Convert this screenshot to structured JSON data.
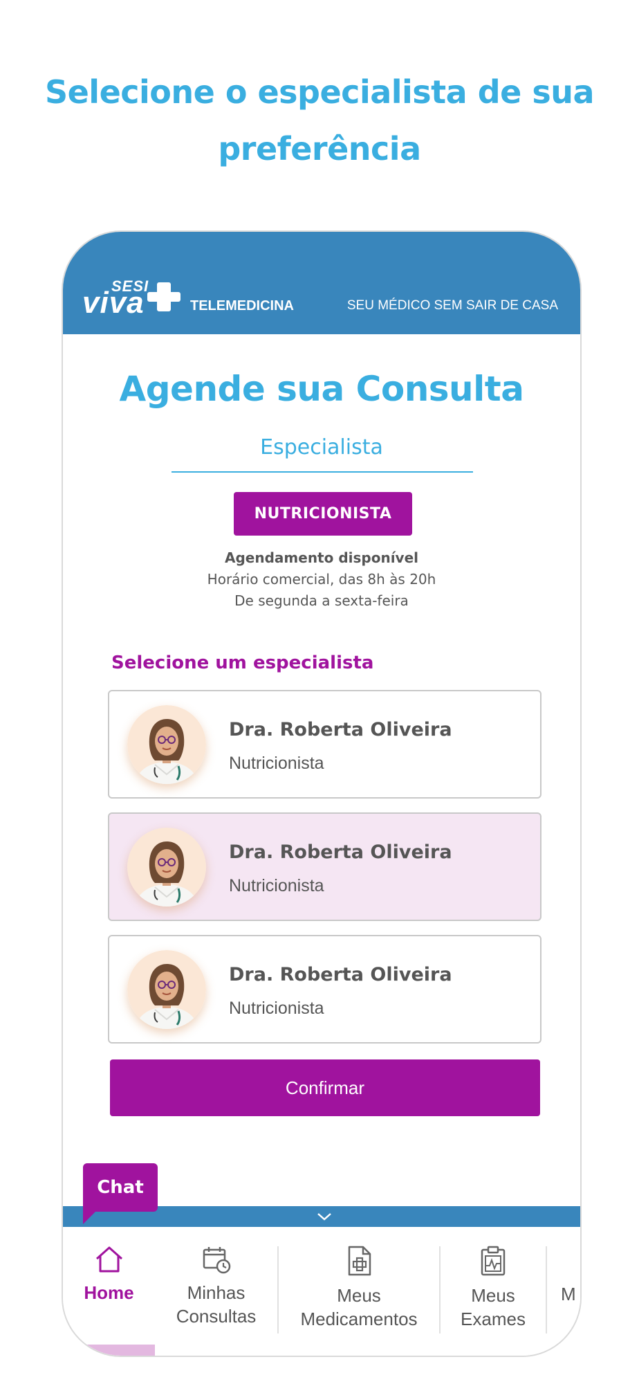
{
  "promo": {
    "headline": "Selecione o especialista de sua preferência"
  },
  "app_header": {
    "logo_sesi": "SESI",
    "logo_viva": "viva",
    "brand": "TELEMEDICINA",
    "slogan": "SEU MÉDICO SEM SAIR DE CASA"
  },
  "main": {
    "title": "Agende sua Consulta",
    "subtitle": "Especialista",
    "specialty": "NUTRICIONISTA",
    "availability": {
      "heading": "Agendamento disponível",
      "hours": "Horário comercial, das 8h às 20h",
      "days": "De segunda a sexta-feira"
    },
    "section_label": "Selecione um especialista",
    "doctors": [
      {
        "name": "Dra. Roberta Oliveira",
        "role": "Nutricionista",
        "selected": false
      },
      {
        "name": "Dra. Roberta Oliveira",
        "role": "Nutricionista",
        "selected": true
      },
      {
        "name": "Dra. Roberta Oliveira",
        "role": "Nutricionista",
        "selected": false
      }
    ],
    "confirm_label": "Confirmar"
  },
  "chat": {
    "label": "Chat"
  },
  "bottom_nav": {
    "items": [
      {
        "line1": "Home",
        "line2": "",
        "icon": "home-icon",
        "active": true
      },
      {
        "line1": "Minhas",
        "line2": "Consultas",
        "icon": "calendar-clock-icon",
        "active": false
      },
      {
        "line1": "Meus",
        "line2": "Medicamentos",
        "icon": "prescription-icon",
        "active": false
      },
      {
        "line1": "Meus",
        "line2": "Exames",
        "icon": "clipboard-chart-icon",
        "active": false
      },
      {
        "line1": "M",
        "line2": "",
        "icon": "",
        "active": false
      }
    ]
  },
  "colors": {
    "accent_blue": "#3aaee0",
    "header_blue": "#3986bc",
    "brand_purple": "#a0139e",
    "selected_bg": "#f5e6f3"
  }
}
